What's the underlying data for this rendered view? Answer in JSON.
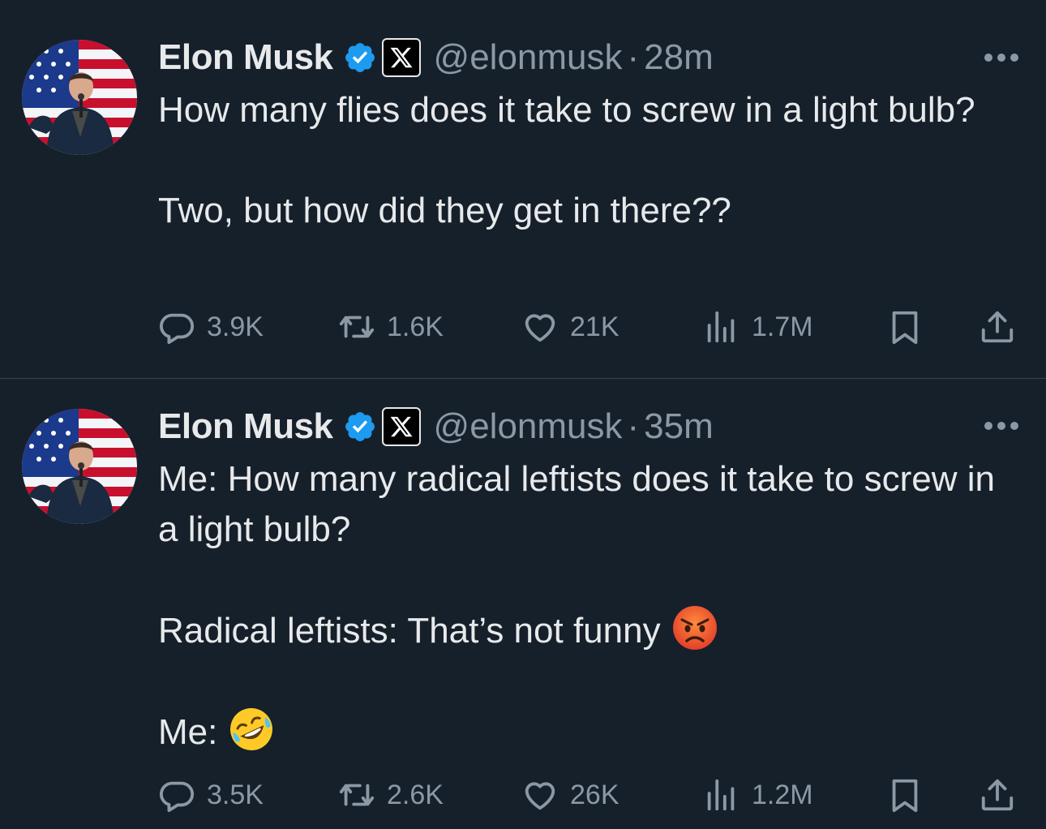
{
  "tweets": [
    {
      "author": {
        "name": "Elon Musk",
        "handle": "@elonmusk",
        "separator": "·",
        "time": "28m"
      },
      "lines": [
        "How many flies does it take to screw in a light bulb?",
        "",
        "Two, but how did they get in there??"
      ],
      "stats": {
        "replies": "3.9K",
        "reposts": "1.6K",
        "likes": "21K",
        "views": "1.7M"
      }
    },
    {
      "author": {
        "name": "Elon Musk",
        "handle": "@elonmusk",
        "separator": "·",
        "time": "35m"
      },
      "lines": [
        "Me: How many radical leftists does it take to screw in a light bulb?",
        "",
        "Radical leftists: That’s not funny",
        "",
        "Me:"
      ],
      "emojis": {
        "line3": "angry-face-emoji",
        "line5": "rolling-on-floor-laughing-emoji"
      },
      "stats": {
        "replies": "3.5K",
        "reposts": "2.6K",
        "likes": "26K",
        "views": "1.2M"
      }
    }
  ],
  "colors": {
    "background": "#16202b",
    "text": "#e7e9ea",
    "muted": "#8b98a5",
    "verified": "#1d9bf0",
    "divider": "#38444d"
  },
  "icons": {
    "reply": "reply-icon",
    "repost": "repost-icon",
    "like": "heart-icon",
    "views": "views-chart-icon",
    "bookmark": "bookmark-icon",
    "share": "share-icon",
    "more": "more-icon",
    "verified": "verified-badge-icon",
    "affiliate": "x-logo-icon"
  }
}
